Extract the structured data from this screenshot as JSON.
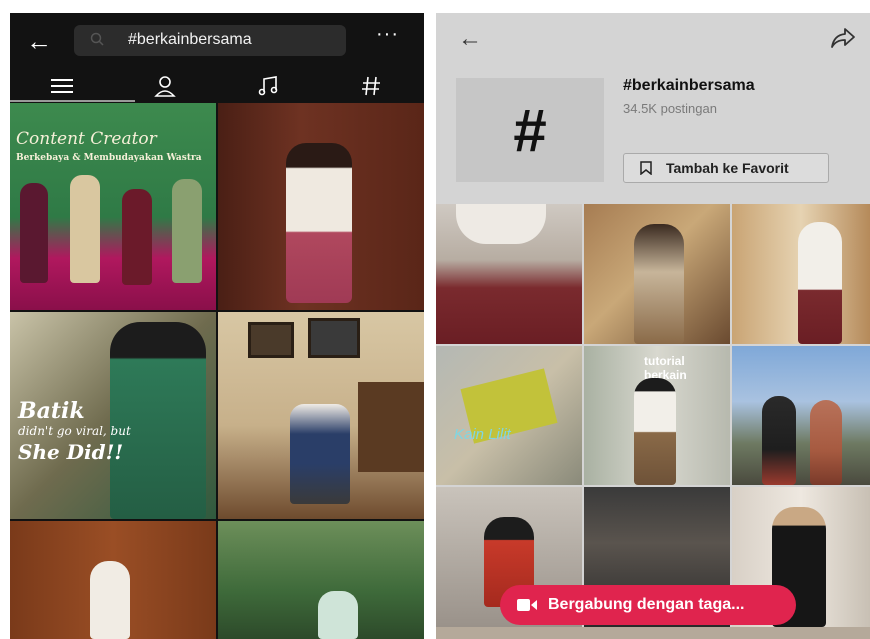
{
  "left": {
    "search_query": "#berkainbersama",
    "more_label": "···",
    "tabs": [
      "top",
      "accounts",
      "sounds",
      "hashtags"
    ],
    "posts": [
      {
        "lines": [
          "Content Creator",
          "Berkebaya & Membudayakan Wastra"
        ]
      },
      {
        "lines": []
      },
      {
        "lines": [
          "Batik",
          "didn't go viral, but",
          "She Did!!"
        ]
      },
      {
        "lines": []
      },
      {
        "lines": []
      },
      {
        "lines": []
      }
    ]
  },
  "right": {
    "hashtag_symbol": "#",
    "hashtag_title": "#berkainbersama",
    "post_count": "34.5K postingan",
    "favorite_button": "Tambah ke Favorit",
    "join_button": "Bergabung dengan taga...",
    "videos": [
      {
        "caption": ""
      },
      {
        "caption": ""
      },
      {
        "caption": ""
      },
      {
        "caption": "Kain Lilit"
      },
      {
        "caption": "tutorial berkain"
      },
      {
        "caption": ""
      },
      {
        "caption": ""
      },
      {
        "caption": ""
      },
      {
        "caption": ""
      }
    ]
  }
}
